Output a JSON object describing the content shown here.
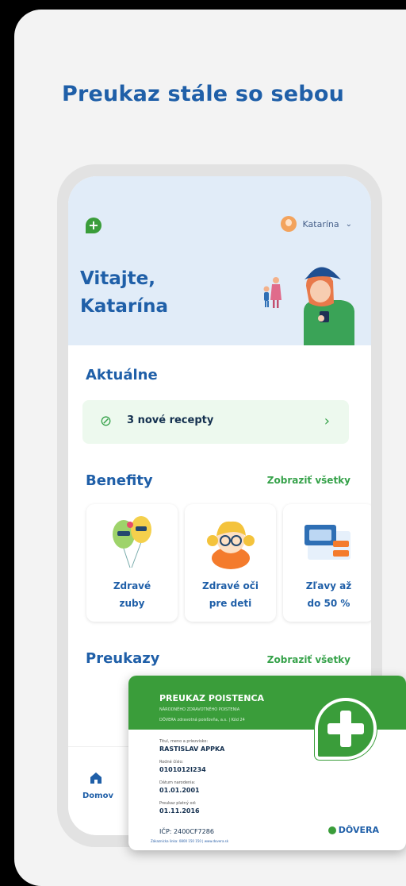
{
  "headline": "Preukaz stále so sebou",
  "header": {
    "user_name": "Katarína"
  },
  "welcome": {
    "line1": "Vitajte,",
    "line2": "Katarína"
  },
  "aktualne": {
    "title": "Aktuálne",
    "prescriptions_label": "3 nové recepty"
  },
  "benefity": {
    "title": "Benefity",
    "view_all": "Zobraziť všetky",
    "items": [
      {
        "label": "Zdravé\nzuby"
      },
      {
        "label": "Zdravé oči\npre deti"
      },
      {
        "label": "Zľavy až\ndo 50 %"
      }
    ]
  },
  "preukazy": {
    "title": "Preukazy",
    "view_all": "Zobraziť všetky"
  },
  "tabbar": {
    "home_label": "Domov"
  },
  "card": {
    "title": "PREUKAZ POISTENCA",
    "subtitle": "NÁRODNÉHO ZDRAVOTNÉHO POISTENIA",
    "insurer_line": "DÔVERA zdravotná poisťovňa, a.s.  |  Kód 24",
    "name_key": "Titul, meno a priezvisko:",
    "name_value": "RASTISLAV APPKA",
    "id_key": "Rodné číslo:",
    "id_value": "0101012I234",
    "dob_key": "Dátum narodenia:",
    "dob_value": "01.01.2001",
    "valid_key": "Preukaz platný od:",
    "valid_value": "01.11.2016",
    "icp": "IČP: 2400CF7286",
    "footer": "Zákaznícka linka: 0800 150 150  |  www.dovera.sk",
    "brand": "DÔVERA"
  },
  "colors": {
    "brand_blue": "#1f5fa8",
    "brand_green": "#3a9d3a",
    "header_bg": "#e1ecf8"
  }
}
